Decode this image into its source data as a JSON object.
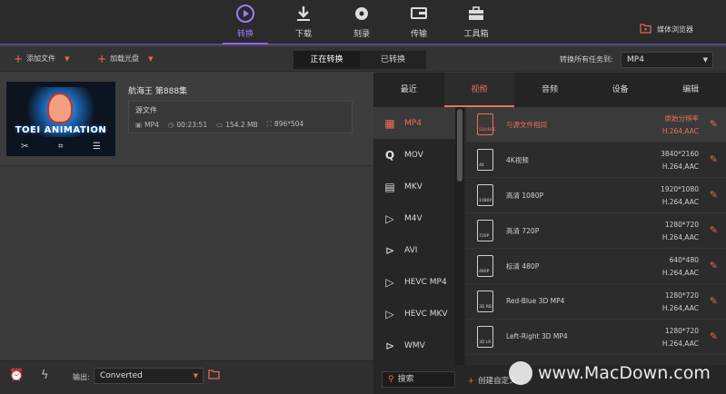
{
  "nav": {
    "items": [
      {
        "label": "转换",
        "icon": "convert-icon",
        "active": true
      },
      {
        "label": "下载",
        "icon": "download-icon",
        "active": false
      },
      {
        "label": "刻录",
        "icon": "burn-disc-icon",
        "active": false
      },
      {
        "label": "传输",
        "icon": "transfer-icon",
        "active": false
      },
      {
        "label": "工具箱",
        "icon": "toolbox-icon",
        "active": false
      }
    ],
    "media_browser": "媒体浏览器"
  },
  "toolbar": {
    "add_file": "添加文件",
    "load_disc": "加载光盘",
    "tab_converting": "正在转换",
    "tab_converted": "已转换",
    "convert_all_label": "转换所有任务到:",
    "convert_all_value": "MP4"
  },
  "file": {
    "title": "航海王 第888集",
    "source_label": "源文件",
    "format": "MP4",
    "duration": "00:23:51",
    "size": "154.2 MB",
    "resolution": "896*504",
    "thumbnail_brand": "TOEI ANIMATION"
  },
  "bottom": {
    "output_label": "输出:",
    "output_value": "Converted"
  },
  "panel": {
    "tabs": [
      "最近",
      "视频",
      "音频",
      "设备",
      "编辑"
    ],
    "active_tab": 1,
    "formats": [
      {
        "label": "MP4",
        "icon": "film-icon"
      },
      {
        "label": "MOV",
        "icon": "quicktime-icon"
      },
      {
        "label": "MKV",
        "icon": "mkv-icon"
      },
      {
        "label": "M4V",
        "icon": "m4v-icon"
      },
      {
        "label": "AVI",
        "icon": "play-circle-icon"
      },
      {
        "label": "HEVC MP4",
        "icon": "hevc-icon"
      },
      {
        "label": "HEVC MKV",
        "icon": "hevc-icon"
      },
      {
        "label": "WMV",
        "icon": "play-circle-icon"
      }
    ],
    "presets": [
      {
        "name": "与源文件相同",
        "res": "原始分辨率",
        "codec": "H.264,AAC",
        "tag": "SOURCE"
      },
      {
        "name": "4K视频",
        "res": "3840*2160",
        "codec": "H.264,AAC",
        "tag": "4K"
      },
      {
        "name": "高清 1080P",
        "res": "1920*1080",
        "codec": "H.264,AAC",
        "tag": "1080P"
      },
      {
        "name": "高清 720P",
        "res": "1280*720",
        "codec": "H.264,AAC",
        "tag": "720P"
      },
      {
        "name": "标清 480P",
        "res": "640*480",
        "codec": "H.264,AAC",
        "tag": "480P"
      },
      {
        "name": "Red-Blue 3D MP4",
        "res": "1280*720",
        "codec": "H.264,AAC",
        "tag": "3D RB"
      },
      {
        "name": "Left-Right 3D MP4",
        "res": "1280*720",
        "codec": "H.264,AAC",
        "tag": "3D LR"
      }
    ],
    "search_placeholder": "搜索",
    "create_custom": "创建自定义"
  },
  "watermark": "www.MacDown.com",
  "colors": {
    "accent": "#ee6f58",
    "nav_active": "#9b7cff"
  }
}
